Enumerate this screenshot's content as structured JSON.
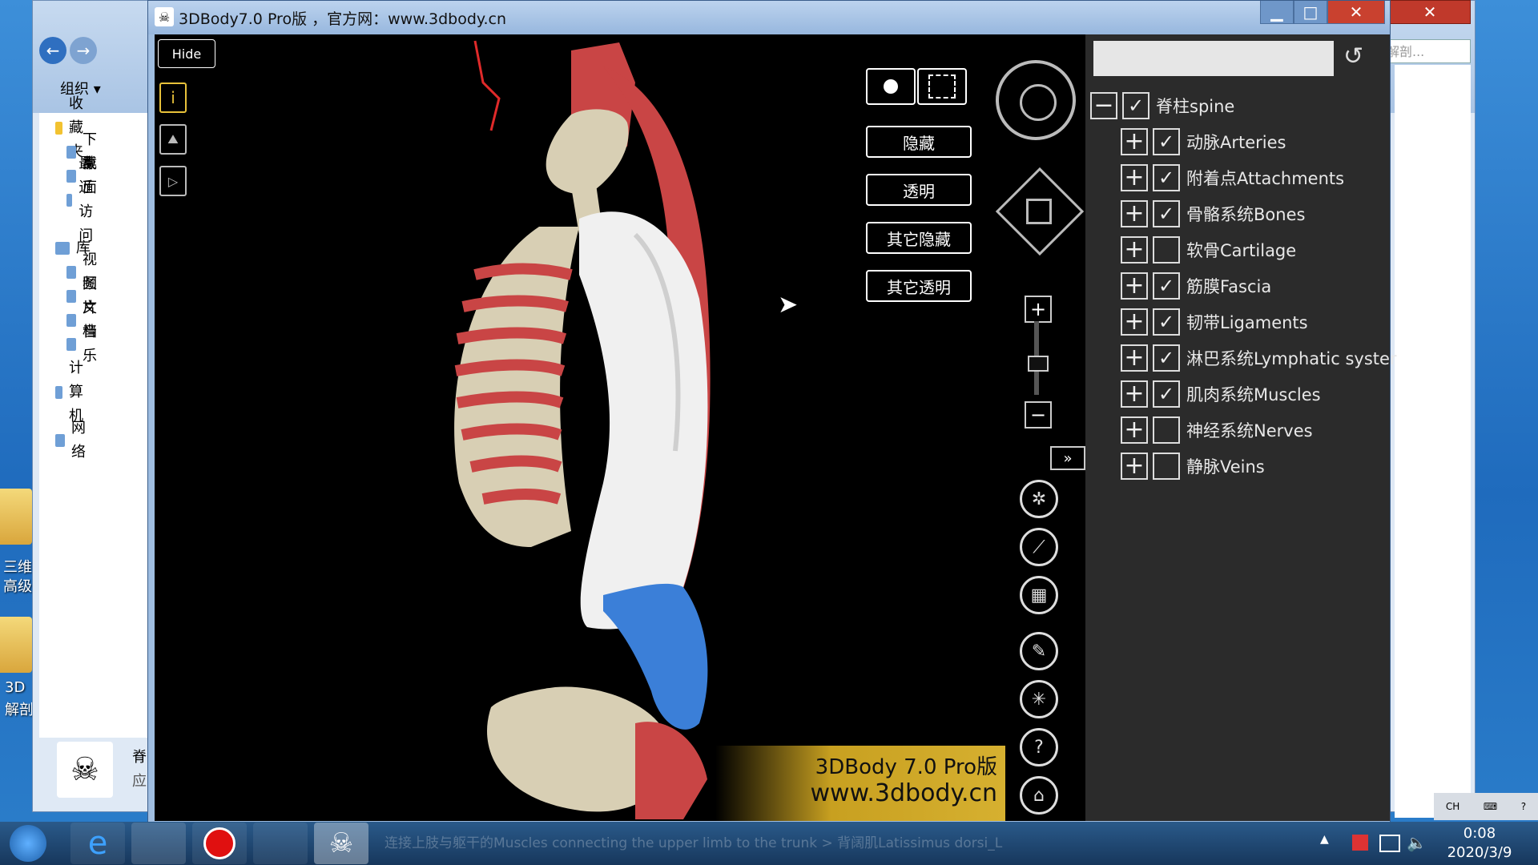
{
  "window": {
    "title": "3DBody7.0 Pro版 ，官方网：www.3dbody.cn",
    "minimize": "▁",
    "maximize": "□",
    "close": "✕"
  },
  "explorer": {
    "organize": "组织 ▾",
    "search_placeholder": "解剖...",
    "nav": [
      {
        "label": "收藏夹",
        "icon": "star-icon"
      },
      {
        "label": "下载",
        "icon": "folder-icon"
      },
      {
        "label": "桌面",
        "icon": "desktop-icon"
      },
      {
        "label": "最近访问",
        "icon": "recent-icon"
      },
      {
        "label": "库",
        "icon": "library-icon"
      },
      {
        "label": "视频",
        "icon": "video-icon"
      },
      {
        "label": "图片",
        "icon": "picture-icon"
      },
      {
        "label": "文档",
        "icon": "document-icon"
      },
      {
        "label": "音乐",
        "icon": "music-icon"
      },
      {
        "label": "计算机",
        "icon": "computer-icon"
      },
      {
        "label": "网络",
        "icon": "network-icon"
      }
    ],
    "details_title": "脊",
    "details_sub": "应"
  },
  "desktop": {
    "labels": [
      "三维",
      "高级",
      "3D",
      "解剖"
    ]
  },
  "viewer": {
    "hide_label": "Hide",
    "buttons": {
      "hide": "隐藏",
      "transparent": "透明",
      "hide_others": "其它隐藏",
      "transparent_others": "其它透明"
    },
    "expand_label": "»",
    "zoom_in": "+",
    "zoom_out": "−",
    "zoom_level": 0.35,
    "help_label": "?",
    "watermark_line1": "3DBody 7.0 Pro版",
    "watermark_line2": "www.3dbody.cn"
  },
  "panel": {
    "search_value": "",
    "tree": [
      {
        "label": "脊柱spine",
        "level": 0,
        "expanded": true,
        "checked": true
      },
      {
        "label": "动脉Arteries",
        "level": 1,
        "expanded": false,
        "checked": true
      },
      {
        "label": "附着点Attachments",
        "level": 1,
        "expanded": false,
        "checked": true
      },
      {
        "label": "骨骼系统Bones",
        "level": 1,
        "expanded": false,
        "checked": true
      },
      {
        "label": "软骨Cartilage",
        "level": 1,
        "expanded": false,
        "checked": false
      },
      {
        "label": "筋膜Fascia",
        "level": 1,
        "expanded": false,
        "checked": true
      },
      {
        "label": "韧带Ligaments",
        "level": 1,
        "expanded": false,
        "checked": true
      },
      {
        "label": "淋巴系统Lymphatic syster",
        "level": 1,
        "expanded": false,
        "checked": true
      },
      {
        "label": "肌肉系统Muscles",
        "level": 1,
        "expanded": false,
        "checked": true
      },
      {
        "label": "神经系统Nerves",
        "level": 1,
        "expanded": false,
        "checked": false
      },
      {
        "label": "静脉Veins",
        "level": 1,
        "expanded": false,
        "checked": false
      }
    ]
  },
  "taskbar": {
    "status_text": "连接上肢与躯干的Muscles connecting the upper limb to the trunk > 背阔肌Latissimus dorsi_L",
    "time": "0:08",
    "date": "2020/3/9",
    "ime": "CH"
  },
  "colors": {
    "muscle": "#c94545",
    "bone": "#d8cfb4",
    "fascia": "#f0f0f0",
    "highlight": "#3b7fd8",
    "watermark_bg": "#c8a020"
  }
}
